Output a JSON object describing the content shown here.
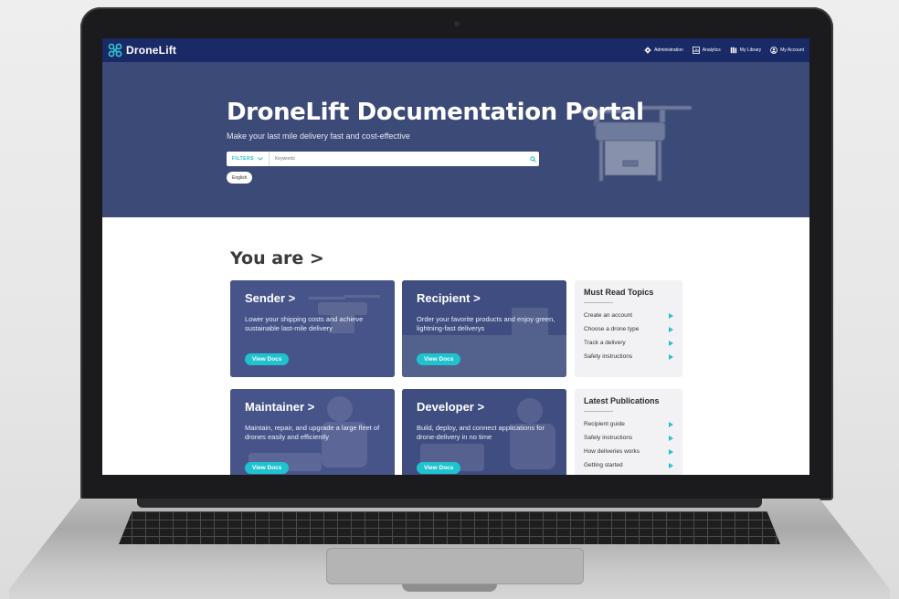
{
  "site": {
    "logo_text": "DroneLift",
    "nav": [
      {
        "label": "Administration",
        "icon": "gear-icon"
      },
      {
        "label": "Analytics",
        "icon": "chart-icon"
      },
      {
        "label": "My Library",
        "icon": "library-icon"
      },
      {
        "label": "My Account",
        "icon": "account-icon"
      }
    ]
  },
  "hero": {
    "title": "DroneLift Documentation Portal",
    "subtitle": "Make your last mile delivery fast and cost-effective",
    "filters_label": "FILTERS",
    "search_placeholder": "Keywords",
    "language": "English"
  },
  "content": {
    "heading": "You are >",
    "cards": [
      {
        "title": "Sender >",
        "desc": "Lower your shipping costs and achieve sustainable last-mile delivery",
        "button": "View Docs"
      },
      {
        "title": "Recipient >",
        "desc": "Order your favorite products and enjoy green, lightning-fast deliverys",
        "button": "View Docs"
      },
      {
        "title": "Maintainer >",
        "desc": "Maintain, repair, and upgrade a large fleet of drones easily and efficiently",
        "button": "View Docs"
      },
      {
        "title": "Developer >",
        "desc": "Build, deploy, and connect applications for drone-delivery in no time",
        "button": "View Docs"
      }
    ],
    "must_read": {
      "title": "Must Read Topics",
      "items": [
        "Create an account",
        "Choose a drone type",
        "Track a delivery",
        "Safety instructions"
      ]
    },
    "latest": {
      "title": "Latest Publications",
      "items": [
        "Recipient guide",
        "Safety instructions",
        "How deliveries works",
        "Getting started"
      ]
    }
  },
  "colors": {
    "nav_bg": "#1a2a66",
    "hero_bg": "#3c4a78",
    "card_bg": "#3f4d80",
    "accent": "#1fc2cf"
  }
}
